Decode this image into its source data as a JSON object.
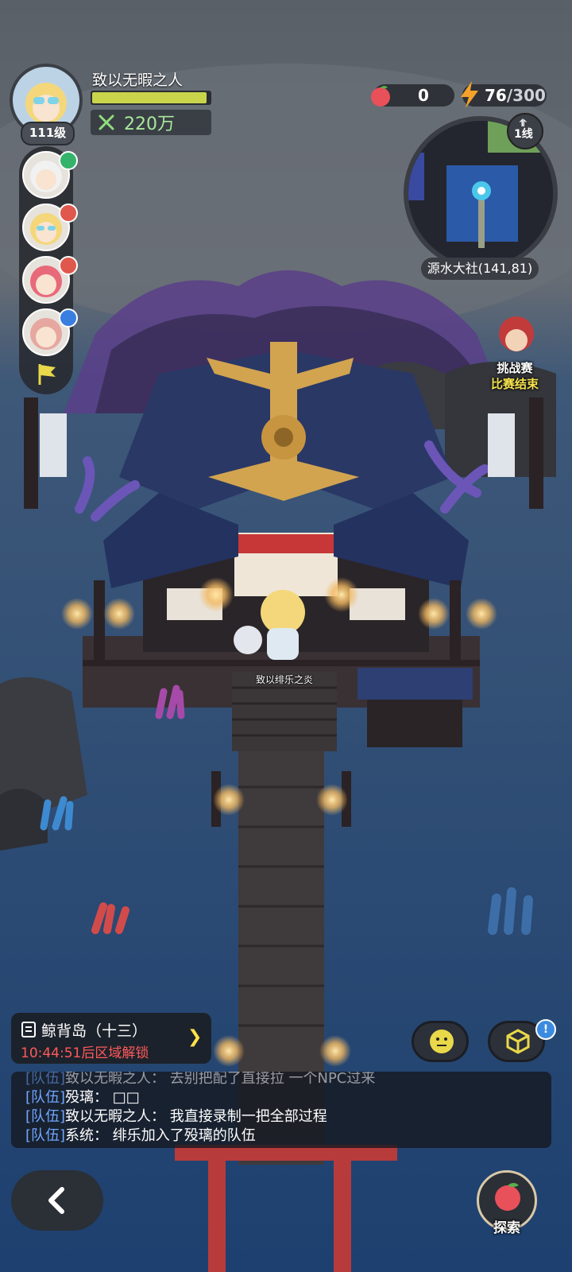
{
  "player": {
    "name": "致以无暇之人",
    "level_label": "111级",
    "xp_fraction": 0.97,
    "power_value": "220万"
  },
  "party": {
    "members": [
      {
        "icon": "party-member-1-avatar",
        "badge_color": "#36b36b"
      },
      {
        "icon": "party-member-2-avatar",
        "badge_color": "#e0574d"
      },
      {
        "icon": "party-member-3-avatar",
        "badge_color": "#e0574d"
      },
      {
        "icon": "party-member-4-avatar",
        "badge_color": "#3a7fe0"
      }
    ],
    "flag_icon": "team-flag-icon"
  },
  "resources": {
    "peach": {
      "icon": "peach-icon",
      "value": "0"
    },
    "stamina": {
      "icon": "lightning-icon",
      "value": "76",
      "max": "/300"
    }
  },
  "minimap": {
    "location": "源水大社(141,81)",
    "line_icon": "signal-icon",
    "line_label": "1线"
  },
  "event": {
    "title": "挑战赛",
    "status": "比赛结束"
  },
  "npc": {
    "name": "致以绯乐之炎"
  },
  "quest": {
    "title": "鲸背岛（十三）",
    "timer": "10:44:51后区域解锁"
  },
  "chat": {
    "lines": [
      {
        "channel": "[队伍]",
        "text": "致以无暇之人：  去别把配了直接拉  一个NPC过来"
      },
      {
        "channel": "[队伍]",
        "text": "殁璃：  □□"
      },
      {
        "channel": "[队伍]",
        "text": "致以无暇之人：  我直接录制一把全部过程"
      },
      {
        "channel": "[队伍]",
        "text": "系统：  绯乐加入了殁璃的队伍"
      }
    ]
  },
  "buttons": {
    "emote_icon": "smiley-face-icon",
    "package_icon": "cube-box-icon",
    "notice_mark": "!",
    "back_icon": "back-arrow-icon",
    "explore_label": "探索"
  },
  "colors": {
    "sea": "#1f4575",
    "fog": "#5b6470",
    "roof": "#2a3866",
    "gold": "#d2a450",
    "deck": "#3c3538",
    "xp": "#c9d44a",
    "timer": "#ff5a5a",
    "chat_channel": "#6fa6ff"
  }
}
